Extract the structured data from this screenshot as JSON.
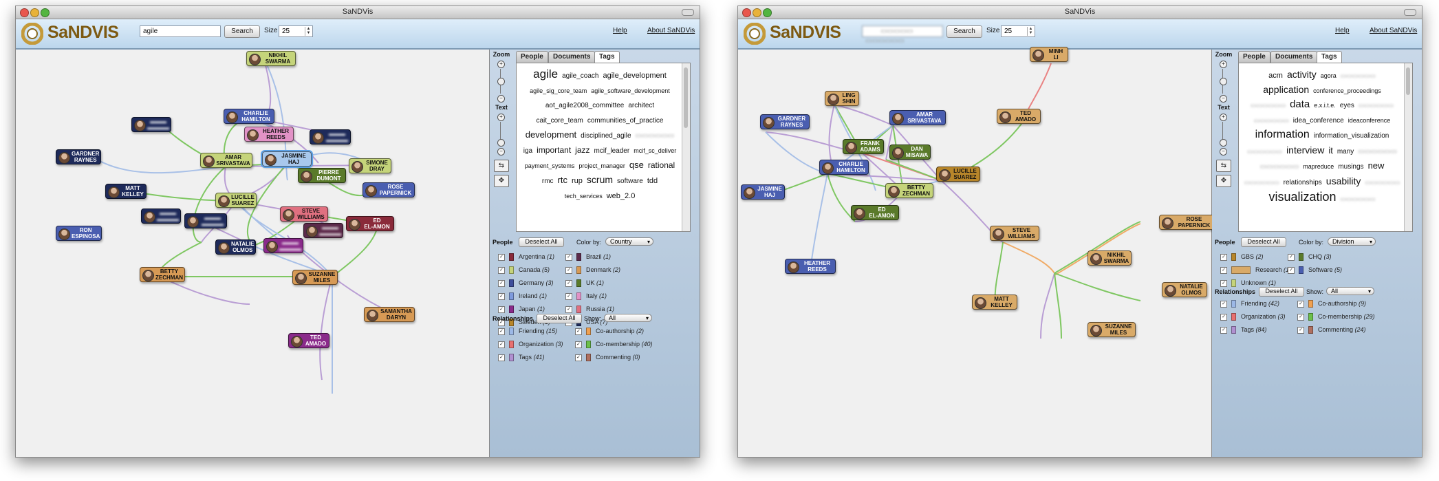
{
  "windows": [
    {
      "title": "SaNDVis",
      "logo": "SaNDVIS",
      "search_value": "agile",
      "search_blurred": false,
      "search_label": "Search",
      "size_label": "Size",
      "size_value": "25",
      "help": "Help",
      "about": "About SaNDVis",
      "zoom_label": "Zoom",
      "text_label": "Text",
      "tabs": [
        "People",
        "Documents",
        "Tags"
      ],
      "active_tab": "Tags",
      "cloud": [
        {
          "t": "agile",
          "s": 17
        },
        {
          "t": "agile_coach",
          "s": 10
        },
        {
          "t": "agile_development",
          "s": 11
        },
        {
          "t": "agile_sig_core_team",
          "s": 9
        },
        {
          "t": "agile_software_development",
          "s": 9
        },
        {
          "t": "aot_agile2008_committee",
          "s": 10
        },
        {
          "t": "architect",
          "s": 10
        },
        {
          "t": "cait_core_team",
          "s": 10
        },
        {
          "t": "communities_of_practice",
          "s": 10
        },
        {
          "t": "development",
          "s": 13
        },
        {
          "t": "disciplined_agile",
          "s": 10
        },
        {
          "t": "",
          "s": 10,
          "blur": true
        },
        {
          "t": "iga",
          "s": 10
        },
        {
          "t": "important",
          "s": 12
        },
        {
          "t": "jazz",
          "s": 12
        },
        {
          "t": "mcif_leader",
          "s": 10
        },
        {
          "t": "mcif_sc_deliver",
          "s": 9
        },
        {
          "t": "payment_systems",
          "s": 9
        },
        {
          "t": "project_manager",
          "s": 9
        },
        {
          "t": "qse",
          "s": 13
        },
        {
          "t": "rational",
          "s": 12
        },
        {
          "t": "rmc",
          "s": 10
        },
        {
          "t": "rtc",
          "s": 13
        },
        {
          "t": "rup",
          "s": 11
        },
        {
          "t": "scrum",
          "s": 14
        },
        {
          "t": "software",
          "s": 10
        },
        {
          "t": "tdd",
          "s": 11
        },
        {
          "t": "tech_services",
          "s": 9
        },
        {
          "t": "web_2.0",
          "s": 11
        }
      ],
      "people_label": "People",
      "deselect": "Deselect All",
      "colorby_label": "Color by:",
      "colorby_value": "Country",
      "people_filters": [
        {
          "name": "Argentina",
          "count": "(1)",
          "color": "#8a2a3a"
        },
        {
          "name": "Brazil",
          "count": "(1)",
          "color": "#5c2a4a"
        },
        {
          "name": "Canada",
          "count": "(5)",
          "color": "#c5d47a"
        },
        {
          "name": "Denmark",
          "count": "(2)",
          "color": "#d79a55"
        },
        {
          "name": "Germany",
          "count": "(3)",
          "color": "#3e4e9c"
        },
        {
          "name": "UK",
          "count": "(1)",
          "color": "#5a7a2a"
        },
        {
          "name": "Ireland",
          "count": "(1)",
          "color": "#7e9adc"
        },
        {
          "name": "Italy",
          "count": "(1)",
          "color": "#e292c6"
        },
        {
          "name": "Japan",
          "count": "(1)",
          "color": "#8a2a8a"
        },
        {
          "name": "Russia",
          "count": "(1)",
          "color": "#e07080"
        },
        {
          "name": "Sweden",
          "count": "(1)",
          "color": "#b8862a"
        },
        {
          "name": "USA",
          "count": "(7)",
          "color": "#1e2a5a"
        }
      ],
      "relationships_label": "Relationships",
      "show_label": "Show:",
      "show_value": "All",
      "rel_filters": [
        {
          "name": "Friending",
          "count": "(15)",
          "color": "#9cb8e6"
        },
        {
          "name": "Co-authorship",
          "count": "(2)",
          "color": "#f0a050"
        },
        {
          "name": "Organization",
          "count": "(3)",
          "color": "#e87070"
        },
        {
          "name": "Co-membership",
          "count": "(40)",
          "color": "#6cc04a"
        },
        {
          "name": "Tags",
          "count": "(41)",
          "color": "#b090d0"
        },
        {
          "name": "Commenting",
          "count": "(0)",
          "color": "#b07060"
        }
      ],
      "nodes": [
        {
          "l1": "NIKHIL",
          "l2": "SWARMA",
          "c": "#c5d47a"
        },
        {
          "l1": "CHARLIE",
          "l2": "HAMILTON",
          "c": "#4a5eb0"
        },
        {
          "l1": "HEATHER",
          "l2": "REEDS",
          "c": "#e292c6"
        },
        {
          "l1": "",
          "l2": "",
          "c": "#1e2a5a",
          "blur": true
        },
        {
          "l1": "",
          "l2": "",
          "c": "#1e2a5a",
          "blur": true
        },
        {
          "l1": "GARDNER",
          "l2": "RAYNES",
          "c": "#1e2a5a"
        },
        {
          "l1": "AMAR",
          "l2": "SRIVASTAVA",
          "c": "#c5d47a"
        },
        {
          "l1": "JASMINE",
          "l2": "HAJ",
          "c": "#a8c8ec",
          "hl": true
        },
        {
          "l1": "SIMONE",
          "l2": "DRAY",
          "c": "#c5d47a"
        },
        {
          "l1": "PIERRE",
          "l2": "DUMONT",
          "c": "#5a7a2a"
        },
        {
          "l1": "MATT",
          "l2": "KELLEY",
          "c": "#1e2a5a"
        },
        {
          "l1": "ROSE",
          "l2": "PAPERNICK",
          "c": "#4a5eb0"
        },
        {
          "l1": "LUCILLE",
          "l2": "SUAREZ",
          "c": "#c5d47a"
        },
        {
          "l1": "",
          "l2": "",
          "c": "#1e2a5a",
          "blur": true
        },
        {
          "l1": "",
          "l2": "",
          "c": "#1e2a5a",
          "blur": true
        },
        {
          "l1": "STEVE",
          "l2": "WILLIAMS",
          "c": "#e07080"
        },
        {
          "l1": "ED",
          "l2": "EL-AMON",
          "c": "#8a2a3a"
        },
        {
          "l1": "",
          "l2": "",
          "c": "#5c2a4a",
          "blur": true
        },
        {
          "l1": "RON",
          "l2": "ESPINOSA",
          "c": "#4a5eb0"
        },
        {
          "l1": "NATALIE",
          "l2": "OLMOS",
          "c": "#1e2a5a"
        },
        {
          "l1": "",
          "l2": "",
          "c": "#8a2a8a",
          "blur": true
        },
        {
          "l1": "BETTY",
          "l2": "ZECHMAN",
          "c": "#d79a55"
        },
        {
          "l1": "SUZANNE",
          "l2": "MILES",
          "c": "#d79a55"
        },
        {
          "l1": "SAMANTHA",
          "l2": "DARYN",
          "c": "#d79a55"
        },
        {
          "l1": "TED",
          "l2": "AMADO",
          "c": "#8a2a8a"
        }
      ]
    },
    {
      "title": "SaNDVis",
      "logo": "SaNDVIS",
      "search_value": "",
      "search_blurred": true,
      "search_label": "Search",
      "size_label": "Size",
      "size_value": "25",
      "help": "Help",
      "about": "About SaNDVis",
      "zoom_label": "Zoom",
      "text_label": "Text",
      "tabs": [
        "People",
        "Documents",
        "Tags"
      ],
      "active_tab": "Tags",
      "cloud": [
        {
          "t": "acm",
          "s": 11
        },
        {
          "t": "activity",
          "s": 14
        },
        {
          "t": "agora",
          "s": 9
        },
        {
          "t": "",
          "s": 9,
          "blur": true
        },
        {
          "t": "application",
          "s": 14
        },
        {
          "t": "conference_proceedings",
          "s": 9
        },
        {
          "t": "",
          "s": 9,
          "blur": true
        },
        {
          "t": "data",
          "s": 15
        },
        {
          "t": "e.x.i.t.e.",
          "s": 9
        },
        {
          "t": "eyes",
          "s": 10
        },
        {
          "t": "",
          "s": 9,
          "blur": true
        },
        {
          "t": "",
          "s": 9,
          "blur": true
        },
        {
          "t": "idea_conference",
          "s": 10
        },
        {
          "t": "ideaconference",
          "s": 9
        },
        {
          "t": "information",
          "s": 16
        },
        {
          "t": "information_visualization",
          "s": 10
        },
        {
          "t": "",
          "s": 9,
          "blur": true
        },
        {
          "t": "interview",
          "s": 14
        },
        {
          "t": "it",
          "s": 13
        },
        {
          "t": "many",
          "s": 10
        },
        {
          "t": "",
          "s": 10,
          "blur": true
        },
        {
          "t": "",
          "s": 10,
          "blur": true
        },
        {
          "t": "mapreduce",
          "s": 9
        },
        {
          "t": "musings",
          "s": 10
        },
        {
          "t": "new",
          "s": 13
        },
        {
          "t": "",
          "s": 9,
          "blur": true
        },
        {
          "t": "relationships",
          "s": 10
        },
        {
          "t": "usability",
          "s": 14
        },
        {
          "t": "",
          "s": 9,
          "blur": true
        },
        {
          "t": "visualization",
          "s": 18
        },
        {
          "t": "",
          "s": 9,
          "blur": true
        }
      ],
      "people_label": "People",
      "deselect": "Deselect All",
      "colorby_label": "Color by:",
      "colorby_value": "Division",
      "people_filters": [
        {
          "name": "GBS",
          "count": "(2)",
          "color": "#b8862a"
        },
        {
          "name": "CHQ",
          "count": "(3)",
          "color": "#5a7a2a"
        },
        {
          "name": "Research",
          "count": "(14)",
          "color": "#d9aa68"
        },
        {
          "name": "Software",
          "count": "(5)",
          "color": "#4a5eb0"
        },
        {
          "name": "Unknown",
          "count": "(1)",
          "color": "#c5d47a"
        }
      ],
      "relationships_label": "Relationships",
      "show_label": "Show:",
      "show_value": "All",
      "rel_filters": [
        {
          "name": "Friending",
          "count": "(42)",
          "color": "#9cb8e6"
        },
        {
          "name": "Co-authorship",
          "count": "(9)",
          "color": "#f0a050"
        },
        {
          "name": "Organization",
          "count": "(3)",
          "color": "#e87070"
        },
        {
          "name": "Co-membership",
          "count": "(29)",
          "color": "#6cc04a"
        },
        {
          "name": "Tags",
          "count": "(84)",
          "color": "#b090d0"
        },
        {
          "name": "Commenting",
          "count": "(24)",
          "color": "#b07060"
        }
      ],
      "nodes": [
        {
          "l1": "MINH",
          "l2": "LI",
          "c": "#d9aa68"
        },
        {
          "l1": "LING",
          "l2": "SHIN",
          "c": "#d9aa68"
        },
        {
          "l1": "GARDNER",
          "l2": "RAYNES",
          "c": "#4a5eb0"
        },
        {
          "l1": "AMAR",
          "l2": "SRIVASTAVA",
          "c": "#4a5eb0"
        },
        {
          "l1": "TED",
          "l2": "AMADO",
          "c": "#d9aa68"
        },
        {
          "l1": "FRANK",
          "l2": "ADAMS",
          "c": "#5a7a2a"
        },
        {
          "l1": "DAN",
          "l2": "MISAWA",
          "c": "#5a7a2a"
        },
        {
          "l1": "CHARLIE",
          "l2": "HAMILTON",
          "c": "#4a5eb0"
        },
        {
          "l1": "LUCILLE",
          "l2": "SUAREZ",
          "c": "#b8862a"
        },
        {
          "l1": "JASMINE",
          "l2": "HAJ",
          "c": "#4a5eb0"
        },
        {
          "l1": "BETTY",
          "l2": "ZECHMAN",
          "c": "#c5d47a"
        },
        {
          "l1": "ED",
          "l2": "EL-AMON",
          "c": "#5a7a2a"
        },
        {
          "l1": "ROSE",
          "l2": "PAPERNICK",
          "c": "#d9aa68"
        },
        {
          "l1": "STEVE",
          "l2": "WILLIAMS",
          "c": "#d9aa68"
        },
        {
          "l1": "NIKHIL",
          "l2": "SWARMA",
          "c": "#d9aa68"
        },
        {
          "l1": "HEATHER",
          "l2": "REEDS",
          "c": "#4a5eb0"
        },
        {
          "l1": "NATALIE",
          "l2": "OLMOS",
          "c": "#d9aa68"
        },
        {
          "l1": "MATT",
          "l2": "KELLEY",
          "c": "#d9aa68"
        },
        {
          "l1": "SUZANNE",
          "l2": "MILES",
          "c": "#d9aa68"
        }
      ]
    }
  ]
}
